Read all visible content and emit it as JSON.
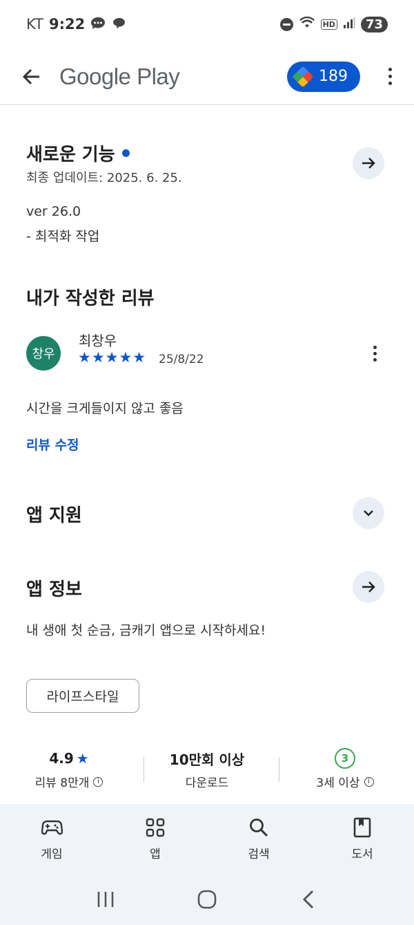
{
  "status_bar": {
    "carrier": "KT",
    "time": "9:22",
    "hd": "HD",
    "battery": "73"
  },
  "app_bar": {
    "title": "Google Play",
    "points": "189"
  },
  "whats_new": {
    "title": "새로운 기능",
    "updated": "최종 업데이트: 2025. 6. 25.",
    "version": "ver 26.0",
    "note": "- 최적화 작업"
  },
  "my_review": {
    "title": "내가 작성한 리뷰",
    "avatar_text": "창우",
    "reviewer": "최창우",
    "rating": 5,
    "stars": "★★★★★",
    "date": "25/8/22",
    "text": "시간을 크게들이지 않고 좋음",
    "edit_link": "리뷰 수정"
  },
  "app_support": {
    "title": "앱 지원"
  },
  "app_info": {
    "title": "앱 정보",
    "description": "내 생애 첫 순금, 금캐기 앱으로 시작하세요!",
    "category_chip": "라이프스타일"
  },
  "stats": {
    "rating": "4.9",
    "rating_star": "★",
    "reviews": "리뷰 8만개",
    "downloads": "10만회 이상",
    "downloads_label": "다운로드",
    "age_badge": "3",
    "age_label": "3세 이상",
    "info_glyph": "i"
  },
  "bottom_nav": {
    "items": [
      {
        "label": "게임",
        "icon": "gamepad-icon"
      },
      {
        "label": "앱",
        "icon": "apps-grid-icon"
      },
      {
        "label": "검색",
        "icon": "search-icon"
      },
      {
        "label": "도서",
        "icon": "book-icon"
      }
    ]
  },
  "colors": {
    "accent": "#0b57d0",
    "avatar_bg": "#1e8268",
    "age_green": "#34a853",
    "nav_bg": "#f0f4f9"
  }
}
